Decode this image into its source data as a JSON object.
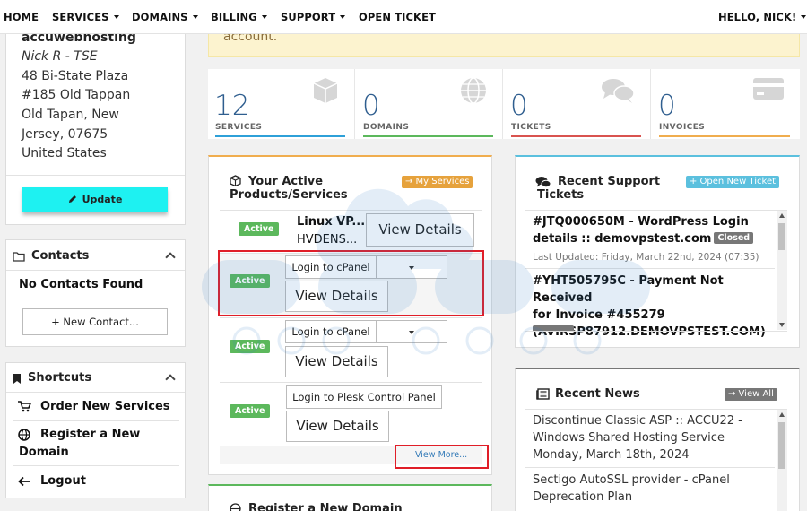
{
  "nav": {
    "home": "HOME",
    "services": "SERVICES",
    "domains": "DOMAINS",
    "billing": "BILLING",
    "support": "SUPPORT",
    "open_ticket": "OPEN TICKET",
    "user": "HELLO, NICK!"
  },
  "profile": {
    "company": "accuwebhosting",
    "name": "Nick R - TSE",
    "address": [
      "48 Bi-State Plaza",
      "#185 Old Tappan",
      "Old Tapan, New",
      "Jersey, 07675",
      "United States"
    ],
    "update_label": "Update"
  },
  "contacts": {
    "title": "Contacts",
    "empty": "No Contacts Found",
    "new_label": "+ New Contact..."
  },
  "shortcuts": {
    "title": "Shortcuts",
    "order": "Order New Services",
    "register_1": "Register a New",
    "register_2": "Domain",
    "logout": "Logout"
  },
  "alert": {
    "text": "account."
  },
  "stats": [
    {
      "value": "12",
      "label": "SERVICES",
      "color": "#2ea0d8",
      "icon": "cube-icon"
    },
    {
      "value": "0",
      "label": "DOMAINS",
      "color": "#5cb85c",
      "icon": "globe-icon"
    },
    {
      "value": "0",
      "label": "TICKETS",
      "color": "#d9534f",
      "icon": "comments-icon"
    },
    {
      "value": "0",
      "label": "INVOICES",
      "color": "#f0ad4e",
      "icon": "credit-card-icon"
    }
  ],
  "products": {
    "title_1": "Your Active",
    "title_2": "Products/Services",
    "my_services": "→ My Services",
    "rows": [
      {
        "status": "Active",
        "name": "Linux VP...",
        "domain": "HVDENS...",
        "view": "View Details"
      },
      {
        "status": "Active",
        "login": "Login to cPanel",
        "view": "View Details"
      },
      {
        "status": "Active",
        "login": "Login to cPanel",
        "view": "View Details"
      },
      {
        "status": "Active",
        "login": "Login to Plesk Control Panel",
        "view": "View Details"
      }
    ],
    "view_more": "View More..."
  },
  "register_domain": {
    "title": "Register a New Domain"
  },
  "tickets": {
    "title_1": "Recent Support",
    "title_2": "Tickets",
    "open_label": "+ Open New Ticket",
    "items": [
      {
        "line1": "#JTQ000650M - WordPress Login",
        "line2": "details :: demovpstest.com",
        "badge": "Closed",
        "meta": "Last Updated: Friday, March 22nd, 2024 (07:35)"
      },
      {
        "line1": "#YHT505795C - Payment Not Received",
        "line2": "for Invoice #455279",
        "line3": "(AVIRSP87912.DEMOVPSTEST.COM)"
      }
    ]
  },
  "news": {
    "title": "Recent News",
    "view_all": "→ View All",
    "items": [
      {
        "line1": "Discontinue Classic ASP :: ACCU22 -",
        "line2": "Windows Shared Hosting Service",
        "date": "Monday, March 18th, 2024"
      },
      {
        "line1": "Sectigo AutoSSL provider - cPanel",
        "line2": "Deprecation Plan"
      }
    ]
  },
  "colors": {
    "accent": "#1ef1f1",
    "highlight": "#e01e28",
    "active": "#5cb85c"
  }
}
